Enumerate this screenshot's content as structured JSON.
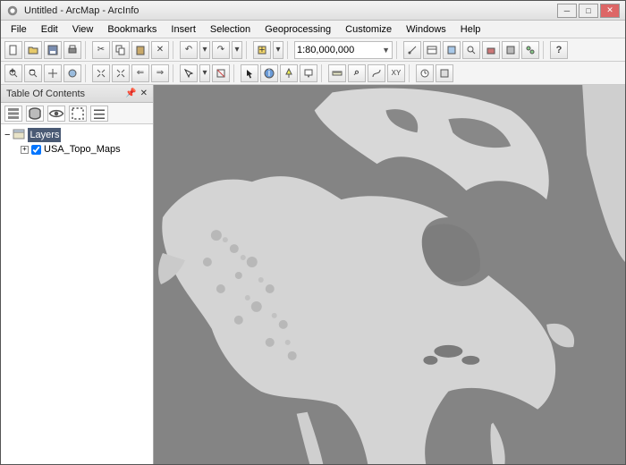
{
  "window": {
    "title": "Untitled - ArcMap - ArcInfo"
  },
  "menu": {
    "items": [
      "File",
      "Edit",
      "View",
      "Bookmarks",
      "Insert",
      "Selection",
      "Geoprocessing",
      "Customize",
      "Windows",
      "Help"
    ]
  },
  "toolbar1": {
    "scale": "1:80,000,000"
  },
  "toc": {
    "title": "Table Of Contents",
    "root_label": "Layers",
    "layer1_label": "USA_Topo_Maps",
    "layer1_checked": true
  },
  "icons": {
    "new": "new-icon",
    "open": "open-icon",
    "save": "save-icon",
    "print": "print-icon",
    "cut": "cut-icon",
    "copy": "copy-icon",
    "paste": "paste-icon",
    "delete": "delete-icon",
    "undo": "undo-icon",
    "redo": "redo-icon",
    "add": "add-data-icon",
    "editor": "editor-icon",
    "t1": "table-window-icon",
    "t2": "catalog-icon",
    "t3": "search-icon",
    "t4": "arc-toolbox-icon",
    "t5": "python-icon",
    "t6": "model-builder-icon",
    "help": "help-icon",
    "zoomin": "zoom-in-icon",
    "zoomout": "zoom-out-icon",
    "pan": "pan-icon",
    "full": "full-extent-icon",
    "fixedzi": "fixed-zoom-in-icon",
    "fixedzo": "fixed-zoom-out-icon",
    "prev": "prev-extent-icon",
    "next": "next-extent-icon",
    "sel": "select-icon",
    "clear": "clear-sel-icon",
    "pointer": "pointer-icon",
    "ident": "identify-icon",
    "hyper": "hyperlink-icon",
    "html": "html-popup-icon",
    "measure": "measure-icon",
    "find": "find-icon",
    "xy": "go-to-xy-icon",
    "time": "time-slider-icon",
    "viewer": "viewer-icon",
    "toc_draworder": "draw-order-icon",
    "toc_source": "source-icon",
    "toc_visibility": "visibility-icon",
    "toc_selection": "selection-icon",
    "toc_options": "options-icon"
  }
}
